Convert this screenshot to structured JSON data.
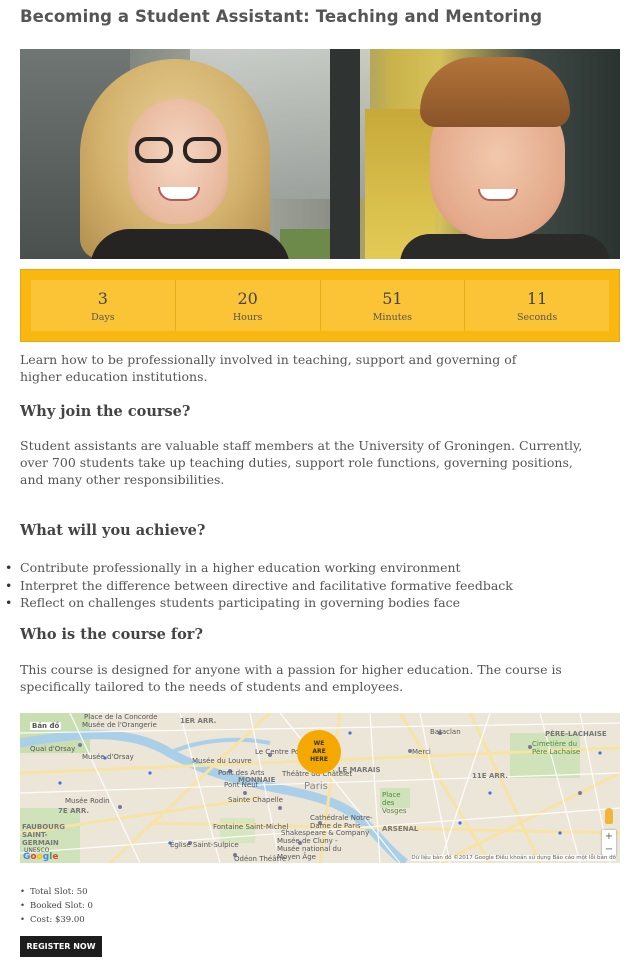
{
  "page": {
    "title": "Becoming a Student Assistant: Teaching and Mentoring"
  },
  "countdown": [
    {
      "value": "3",
      "label": "Days"
    },
    {
      "value": "20",
      "label": "Hours"
    },
    {
      "value": "51",
      "label": "Minutes"
    },
    {
      "value": "11",
      "label": "Seconds"
    }
  ],
  "intro": "Learn how to be professionally involved in teaching, support and governing of higher education institutions.",
  "sections": {
    "why": {
      "heading": "Why join the course?",
      "text": "Student assistants are valuable staff members at the University of Groningen. Currently, over 700 students take up teaching duties, support role functions, governing positions, and many other responsibilities."
    },
    "achieve": {
      "heading": "What will you achieve?",
      "items": [
        "Contribute professionally in a higher education working environment",
        "Interpret the difference between directive and facilitative formative feedback",
        "Reflect on challenges students participating in governing bodies face"
      ]
    },
    "who": {
      "heading": "Who is the course for?",
      "text": "This course is designed for anyone with a passion for higher education. The course is specifically tailored to the needs of students and employees."
    }
  },
  "map": {
    "pin_line1": "WE",
    "pin_line2": "ARE",
    "pin_line3": "HERE",
    "zoom_in": "+",
    "zoom_out": "−",
    "google_logo": "Google",
    "attribution": "Dữ liệu bản đồ ©2017 Google   Điều khoản sử dụng   Báo cáo một lỗi bản đồ",
    "labels": [
      "Bản đồ",
      "Place de la Concorde",
      "Musée de l'Orangerie",
      "1ER ARR.",
      "Musée du Louvre",
      "Le Centre Pompidou",
      "Pont des Arts",
      "Théâtre du Châtelet",
      "LE MARAIS",
      "Pont Neuf",
      "Sainte Chapelle",
      "Paris",
      "Musée Rodin",
      "7E ARR.",
      "FAUBOURG SAINT-GERMAIN",
      "Fontaine Saint-Michel",
      "Cathédrale Notre-Dame de Paris",
      "Shakespeare & Company",
      "Musée de Cluny - Musée national du Moyen Âge",
      "Église Saint-Sulpice",
      "Odéon Théâtre",
      "Merci",
      "Bataclan",
      "PÈRE-LACHAISE",
      "Cimetière du Père Lachaise",
      "11E ARR.",
      "Place des Vosges",
      "ARSENAL",
      "UNESCO",
      "MONNAIE",
      "Quai d'Orsay",
      "Musée d'Orsay"
    ]
  },
  "meta": [
    {
      "label": "Total Slot:",
      "value": "50"
    },
    {
      "label": "Booked Slot:",
      "value": "0"
    },
    {
      "label": "Cost:",
      "value": "$39.00"
    }
  ],
  "register_label": "REGISTER NOW"
}
